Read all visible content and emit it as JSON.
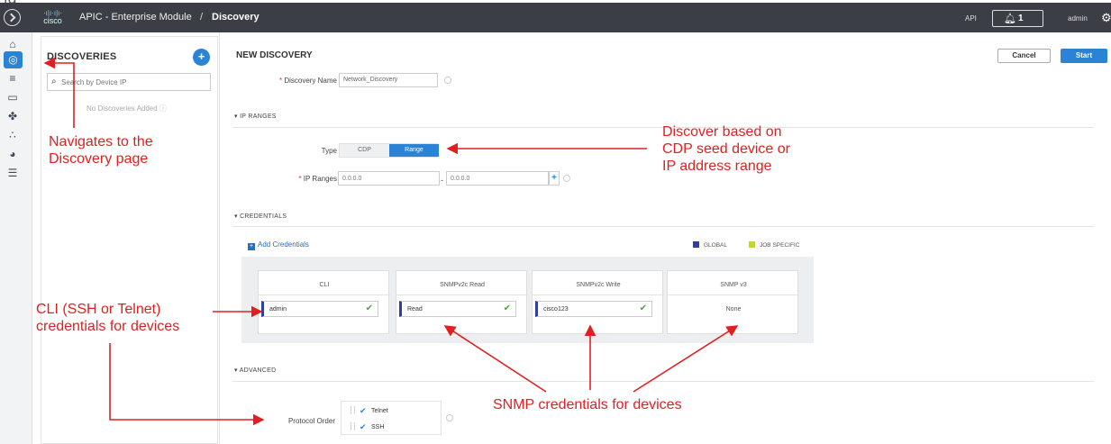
{
  "cutoff_text": "ig",
  "topbar": {
    "logo_bars": "·ı|ı·ı|ı·",
    "logo_word": "cisco",
    "app_title": "APIC - Enterprise Module",
    "separator": "/",
    "crumb": "Discovery",
    "api_label": "API",
    "notifications": "1",
    "user": "admin"
  },
  "rail": {
    "icons": [
      "home-icon",
      "discovery-icon",
      "database-icon",
      "monitor-icon",
      "topology-icon",
      "path-trace-icon",
      "plug-and-play-icon",
      "settings-list-icon"
    ]
  },
  "left_panel": {
    "title": "DISCOVERIES",
    "add_button": "+",
    "search_placeholder": "Search by Device IP",
    "empty_text": "No Discoveries Added"
  },
  "form": {
    "title": "NEW DISCOVERY",
    "cancel": "Cancel",
    "start": "Start",
    "required_mark": "*",
    "discovery_name_label": "Discovery Name",
    "discovery_name_value": "Network_Discovery",
    "ip_ranges_section": "IP RANGES",
    "type_label": "Type",
    "type_options": [
      "CDP",
      "Range"
    ],
    "type_selected": "Range",
    "ip_ranges_label": "IP Ranges",
    "ip_start_placeholder": "0.0.0.0",
    "ip_end_placeholder": "0.0.0.0",
    "ip_dash": "-",
    "ip_add": "+",
    "credentials_section": "CREDENTIALS",
    "add_credentials": "Add Credentials",
    "legend": [
      {
        "label": "GLOBAL",
        "color": "#2e3f9e"
      },
      {
        "label": "JOB SPECIFIC",
        "color": "#c4d62a"
      }
    ],
    "cards": [
      {
        "header": "CLI",
        "value": "admin"
      },
      {
        "header": "SNMPv2c Read",
        "value": "Read"
      },
      {
        "header": "SNMPv2c Write",
        "value": "cisco123"
      },
      {
        "header": "SNMP v3",
        "value": "None"
      }
    ],
    "advanced_section": "ADVANCED",
    "protocol_order_label": "Protocol Order",
    "protocols": [
      "Telnet",
      "SSH"
    ]
  },
  "annotations": {
    "nav": [
      "Navigates  to the",
      "Discovery page"
    ],
    "type": [
      "Discover based on",
      "CDP seed device or",
      "IP address range"
    ],
    "cli": [
      "CLI (SSH or Telnet)",
      "credentials for devices"
    ],
    "snmp": "SNMP credentials for devices"
  },
  "colors": {
    "topbar": "#3b3e44",
    "accent": "#2b83d6",
    "annotation": "#e02020",
    "check": "#4caa3a"
  }
}
